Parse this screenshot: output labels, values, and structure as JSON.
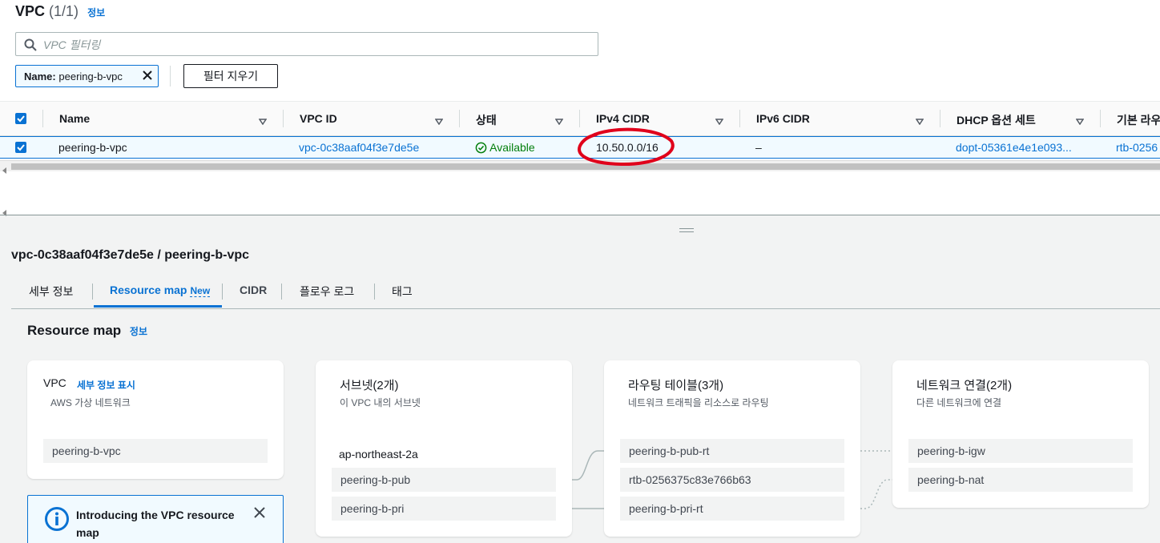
{
  "header": {
    "title": "VPC",
    "count": "(1/1)",
    "info": "정보"
  },
  "search": {
    "placeholder": "VPC 필터링"
  },
  "filter_chip": {
    "key": "Name:",
    "value": "peering-b-vpc"
  },
  "clear_filters": "필터 지우기",
  "columns": [
    "Name",
    "VPC ID",
    "상태",
    "IPv4 CIDR",
    "IPv6 CIDR",
    "DHCP 옵션 세트",
    "기본 라우"
  ],
  "row": {
    "name": "peering-b-vpc",
    "vpc_id": "vpc-0c38aaf04f3e7de5e",
    "status": "Available",
    "ipv4_cidr": "10.50.0.0/16",
    "ipv6_cidr": "–",
    "dhcp": "dopt-05361e4e1e093...",
    "route": "rtb-0256"
  },
  "detail": {
    "title": "vpc-0c38aaf04f3e7de5e / peering-b-vpc"
  },
  "tabs": [
    {
      "label": "세부 정보"
    },
    {
      "label": "Resource map",
      "badge": "New"
    },
    {
      "label": "CIDR"
    },
    {
      "label": "플로우 로그"
    },
    {
      "label": "태그"
    }
  ],
  "resource_map": {
    "title": "Resource map",
    "info": "정보",
    "vpc_card": {
      "title": "VPC",
      "link": "세부 정보 표시",
      "subtitle": "AWS 가상 네트워크",
      "item": "peering-b-vpc"
    },
    "subnets_card": {
      "title": "서브넷(2개)",
      "subtitle": "이 VPC 내의 서브넷",
      "az": "ap-northeast-2a",
      "items": [
        "peering-b-pub",
        "peering-b-pri"
      ]
    },
    "routes_card": {
      "title": "라우팅 테이블(3개)",
      "subtitle": "네트워크 트래픽을 리소스로 라우팅",
      "items": [
        "peering-b-pub-rt",
        "rtb-0256375c83e766b63",
        "peering-b-pri-rt"
      ]
    },
    "network_card": {
      "title": "네트워크 연결(2개)",
      "subtitle": "다른 네트워크에 연결",
      "items": [
        "peering-b-igw",
        "peering-b-nat"
      ]
    },
    "banner": {
      "text": "Introducing the VPC resource map"
    }
  },
  "colors": {
    "accent": "#0972d3",
    "success": "#037f0c",
    "annotation": "#e0001b"
  }
}
